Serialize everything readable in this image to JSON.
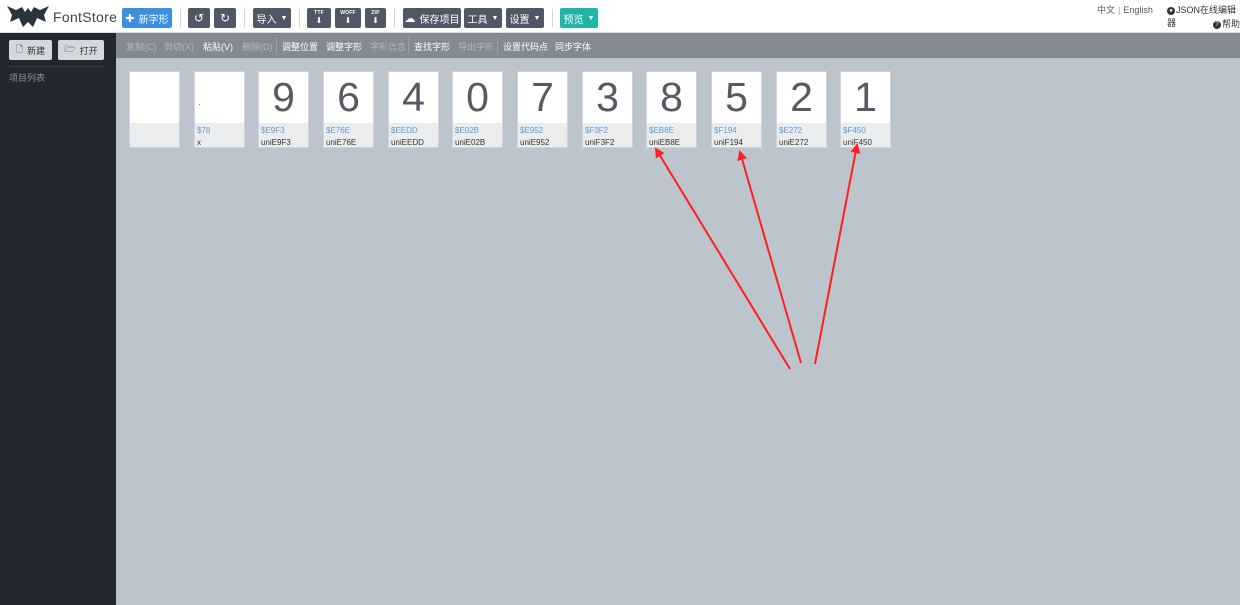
{
  "header": {
    "app_name": "FontStore",
    "buttons": {
      "new_glyph": "新字形",
      "import": "导入",
      "download_ttf": "TTF",
      "download_woff": "WOFF",
      "download_zip": "ZIP",
      "save_project": "保存项目",
      "tools": "工具",
      "settings": "设置",
      "preview": "预览"
    },
    "language_zh": "中文",
    "language_en": "English",
    "json_editor": "JSON在线编辑器",
    "help": "帮助"
  },
  "sidebar": {
    "new_label": "新建",
    "open_label": "打开",
    "project_list_label": "项目列表"
  },
  "editbar": {
    "items": [
      {
        "label": "复制(C)",
        "enabled": false
      },
      {
        "label": "剪切(X)",
        "enabled": false
      },
      {
        "label": "粘贴(V)",
        "enabled": true
      },
      {
        "label": "删除(D)",
        "enabled": false
      },
      {
        "label": "调整位置",
        "enabled": true
      },
      {
        "label": "调整字形",
        "enabled": true
      },
      {
        "label": "字形信息",
        "enabled": false
      },
      {
        "label": "查找字形",
        "enabled": true
      },
      {
        "label": "导出字形",
        "enabled": false
      },
      {
        "label": "设置代码点",
        "enabled": true
      },
      {
        "label": "同步字体",
        "enabled": true
      }
    ]
  },
  "glyphs": [
    {
      "preview": "",
      "code": "",
      "name": ""
    },
    {
      "preview": ".",
      "code": "$78",
      "name": "x"
    },
    {
      "preview": "9",
      "code": "$E9F3",
      "name": "uniE9F3"
    },
    {
      "preview": "6",
      "code": "$E76E",
      "name": "uniE76E"
    },
    {
      "preview": "4",
      "code": "$EEDD",
      "name": "uniEEDD"
    },
    {
      "preview": "0",
      "code": "$E02B",
      "name": "uniE02B"
    },
    {
      "preview": "7",
      "code": "$E952",
      "name": "uniE952"
    },
    {
      "preview": "3",
      "code": "$F3F2",
      "name": "uniF3F2"
    },
    {
      "preview": "8",
      "code": "$EB8E",
      "name": "uniEB8E"
    },
    {
      "preview": "5",
      "code": "$F194",
      "name": "uniF194"
    },
    {
      "preview": "2",
      "code": "$E272",
      "name": "uniE272"
    },
    {
      "preview": "1",
      "code": "$F450",
      "name": "uniF450"
    }
  ],
  "colors": {
    "topbar_bg": "#ffffff",
    "sidebar_bg": "#232731",
    "editbar_bg": "#848a93",
    "workspace_bg": "#bcc4cd",
    "primary_button": "#3d8fe0",
    "preview_button": "#22b4a6",
    "dark_button": "#4f5864",
    "codepoint_text": "#5b9ad8",
    "annotation_arrow": "#ff1f1f"
  },
  "icons": {
    "logo": "bat-logo-icon",
    "new_glyph": "plus-icon",
    "undo": "undo-icon",
    "redo": "redo-icon",
    "save": "cloud-icon",
    "new_file": "file-icon",
    "open_folder": "folder-open-icon",
    "github": "github-icon",
    "help": "question-circle-icon"
  }
}
